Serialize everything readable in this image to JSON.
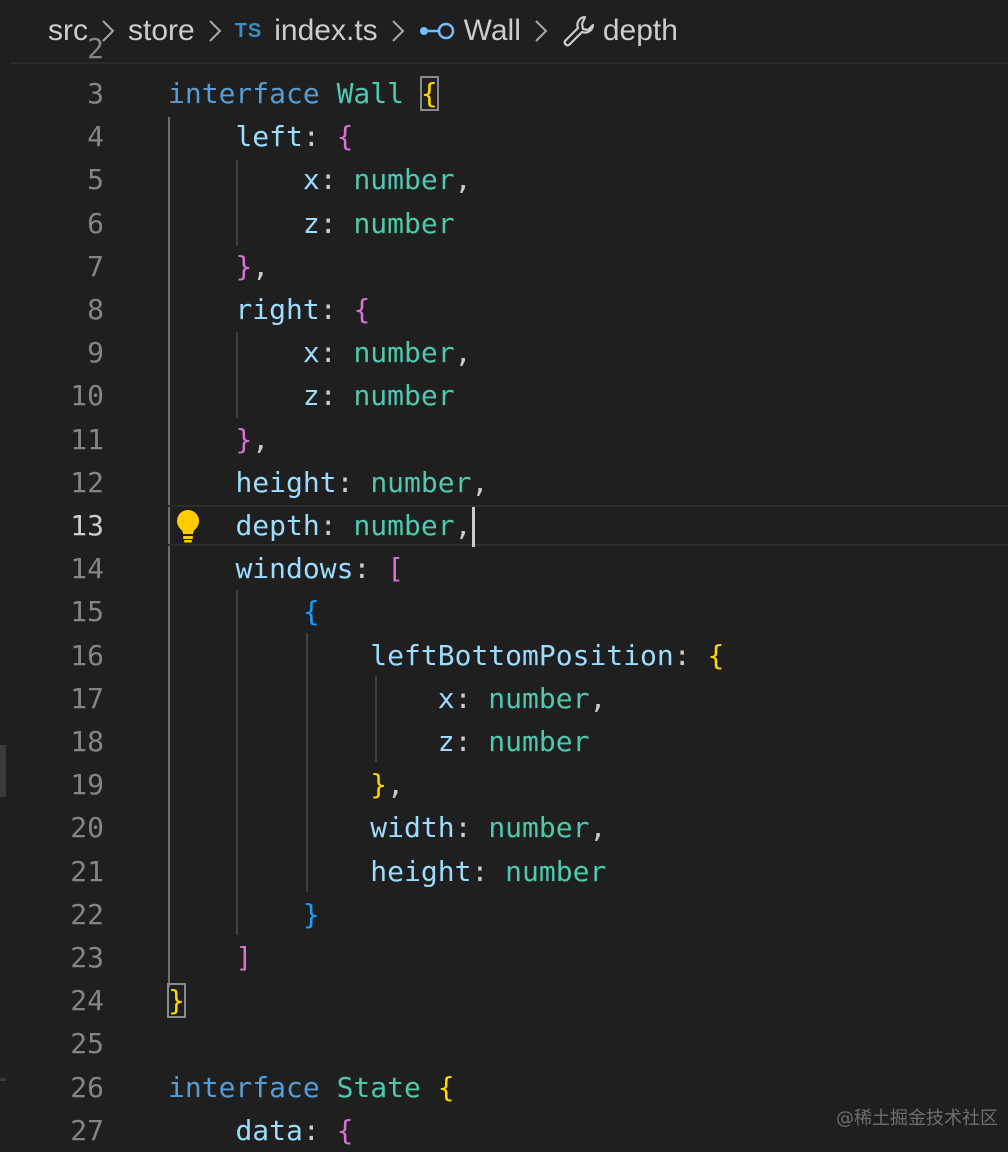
{
  "breadcrumb": {
    "items": [
      "src",
      "store",
      "index.ts",
      "Wall",
      "depth"
    ],
    "file_badge": "TS",
    "separator": ">"
  },
  "editor": {
    "active_line": 13,
    "partial_top_line": "2",
    "lines": [
      {
        "n": "3",
        "tokens": [
          [
            "kw",
            "interface"
          ],
          [
            "pun",
            " "
          ],
          [
            "ty",
            "Wall"
          ],
          [
            "pun",
            " "
          ],
          [
            "b1box",
            "{"
          ]
        ]
      },
      {
        "n": "4",
        "tokens": [
          [
            "ind",
            "    "
          ],
          [
            "prop",
            "left"
          ],
          [
            "pun",
            ": "
          ],
          [
            "b2",
            "{"
          ]
        ]
      },
      {
        "n": "5",
        "tokens": [
          [
            "ind",
            "        "
          ],
          [
            "prop",
            "x"
          ],
          [
            "pun",
            ": "
          ],
          [
            "ty",
            "number"
          ],
          [
            "pun",
            ","
          ]
        ]
      },
      {
        "n": "6",
        "tokens": [
          [
            "ind",
            "        "
          ],
          [
            "prop",
            "z"
          ],
          [
            "pun",
            ": "
          ],
          [
            "ty",
            "number"
          ]
        ]
      },
      {
        "n": "7",
        "tokens": [
          [
            "ind",
            "    "
          ],
          [
            "b2",
            "}"
          ],
          [
            "pun",
            ","
          ]
        ]
      },
      {
        "n": "8",
        "tokens": [
          [
            "ind",
            "    "
          ],
          [
            "prop",
            "right"
          ],
          [
            "pun",
            ": "
          ],
          [
            "b2",
            "{"
          ]
        ]
      },
      {
        "n": "9",
        "tokens": [
          [
            "ind",
            "        "
          ],
          [
            "prop",
            "x"
          ],
          [
            "pun",
            ": "
          ],
          [
            "ty",
            "number"
          ],
          [
            "pun",
            ","
          ]
        ]
      },
      {
        "n": "10",
        "tokens": [
          [
            "ind",
            "        "
          ],
          [
            "prop",
            "z"
          ],
          [
            "pun",
            ": "
          ],
          [
            "ty",
            "number"
          ]
        ]
      },
      {
        "n": "11",
        "tokens": [
          [
            "ind",
            "    "
          ],
          [
            "b2",
            "}"
          ],
          [
            "pun",
            ","
          ]
        ]
      },
      {
        "n": "12",
        "tokens": [
          [
            "ind",
            "    "
          ],
          [
            "prop",
            "height"
          ],
          [
            "pun",
            ": "
          ],
          [
            "ty",
            "number"
          ],
          [
            "pun",
            ","
          ]
        ]
      },
      {
        "n": "13",
        "tokens": [
          [
            "ind",
            "    "
          ],
          [
            "prop",
            "depth"
          ],
          [
            "pun",
            ": "
          ],
          [
            "ty",
            "number"
          ],
          [
            "pun",
            ","
          ],
          [
            "cursor",
            ""
          ]
        ]
      },
      {
        "n": "14",
        "tokens": [
          [
            "ind",
            "    "
          ],
          [
            "prop",
            "windows"
          ],
          [
            "pun",
            ": "
          ],
          [
            "b2",
            "["
          ]
        ]
      },
      {
        "n": "15",
        "tokens": [
          [
            "ind",
            "        "
          ],
          [
            "b3",
            "{"
          ]
        ]
      },
      {
        "n": "16",
        "tokens": [
          [
            "ind",
            "            "
          ],
          [
            "prop",
            "leftBottomPosition"
          ],
          [
            "pun",
            ": "
          ],
          [
            "b1",
            "{"
          ]
        ]
      },
      {
        "n": "17",
        "tokens": [
          [
            "ind",
            "                "
          ],
          [
            "prop",
            "x"
          ],
          [
            "pun",
            ": "
          ],
          [
            "ty",
            "number"
          ],
          [
            "pun",
            ","
          ]
        ]
      },
      {
        "n": "18",
        "tokens": [
          [
            "ind",
            "                "
          ],
          [
            "prop",
            "z"
          ],
          [
            "pun",
            ": "
          ],
          [
            "ty",
            "number"
          ]
        ]
      },
      {
        "n": "19",
        "tokens": [
          [
            "ind",
            "            "
          ],
          [
            "b1",
            "}"
          ],
          [
            "pun",
            ","
          ]
        ]
      },
      {
        "n": "20",
        "tokens": [
          [
            "ind",
            "            "
          ],
          [
            "prop",
            "width"
          ],
          [
            "pun",
            ": "
          ],
          [
            "ty",
            "number"
          ],
          [
            "pun",
            ","
          ]
        ]
      },
      {
        "n": "21",
        "tokens": [
          [
            "ind",
            "            "
          ],
          [
            "prop",
            "height"
          ],
          [
            "pun",
            ": "
          ],
          [
            "ty",
            "number"
          ]
        ]
      },
      {
        "n": "22",
        "tokens": [
          [
            "ind",
            "        "
          ],
          [
            "b3",
            "}"
          ]
        ]
      },
      {
        "n": "23",
        "tokens": [
          [
            "ind",
            "    "
          ],
          [
            "b2",
            "]"
          ]
        ]
      },
      {
        "n": "24",
        "tokens": [
          [
            "b1box",
            "}"
          ]
        ]
      },
      {
        "n": "25",
        "tokens": []
      },
      {
        "n": "26",
        "tokens": [
          [
            "kw",
            "interface"
          ],
          [
            "pun",
            " "
          ],
          [
            "ty",
            "State"
          ],
          [
            "pun",
            " "
          ],
          [
            "b1",
            "{"
          ]
        ]
      },
      {
        "n": "27",
        "tokens": [
          [
            "ind",
            "    "
          ],
          [
            "prop",
            "data"
          ],
          [
            "pun",
            ": "
          ],
          [
            "b2",
            "{"
          ]
        ]
      }
    ]
  },
  "lightbulb": {
    "icon": "lightbulb-icon",
    "color": "#ffcc00"
  },
  "watermark": "@稀土掘金技术社区",
  "colors": {
    "background": "#1f1f1f",
    "keyword": "#569cd6",
    "type": "#4ec9b0",
    "property": "#9cdcfe",
    "bracket1": "#ffd700",
    "bracket2": "#da70d6",
    "bracket3": "#179fff"
  }
}
